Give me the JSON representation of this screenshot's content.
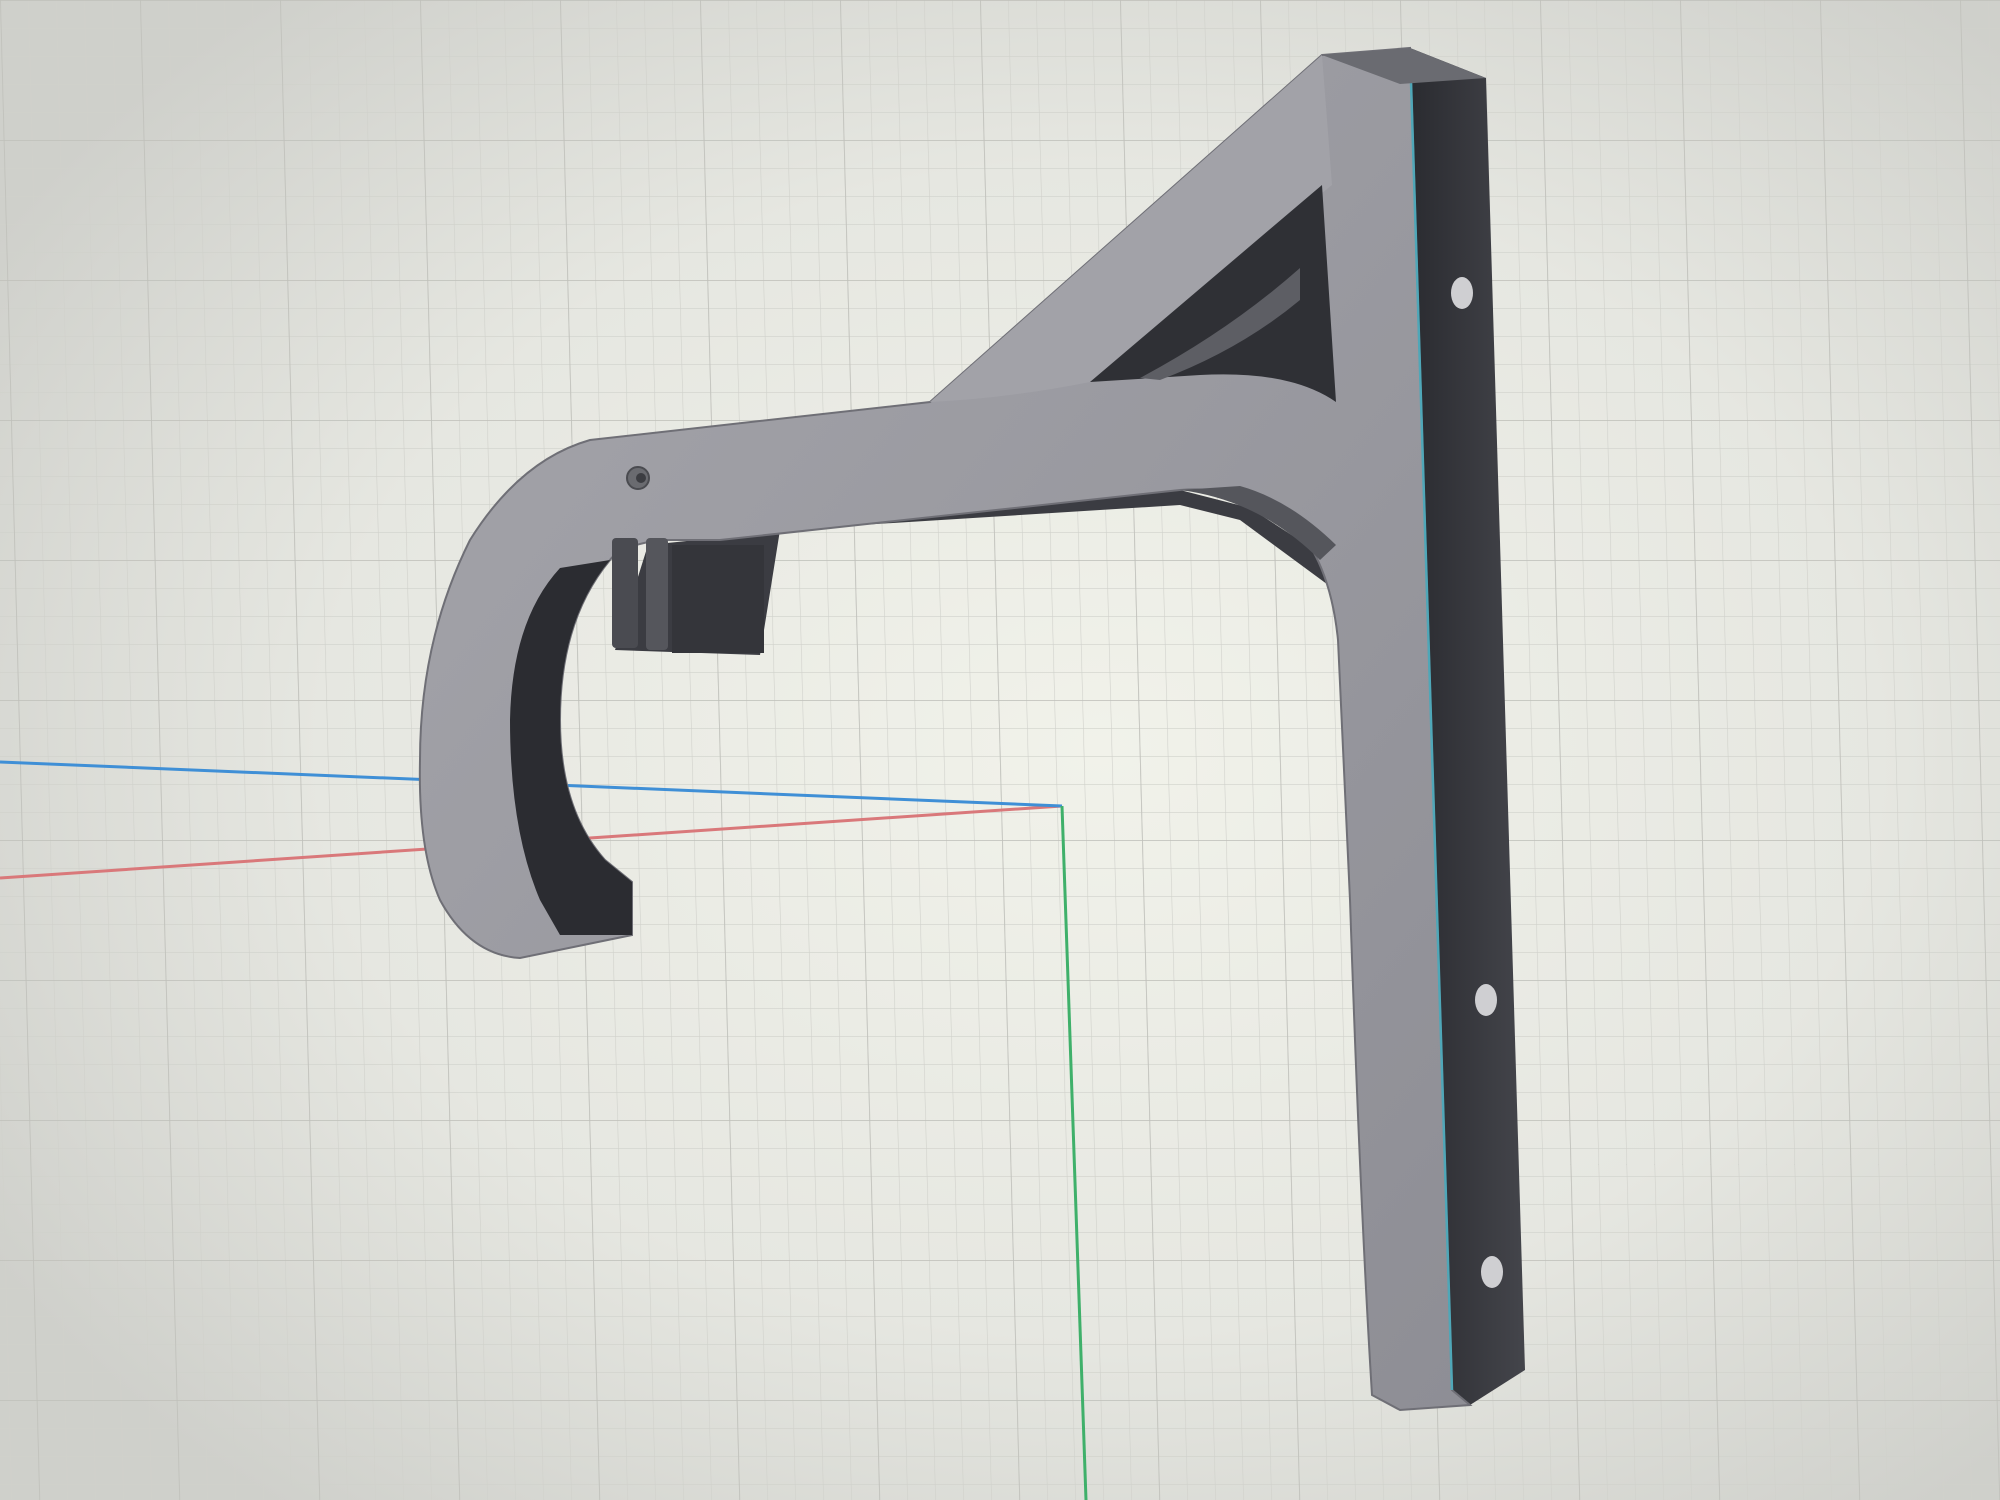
{
  "viewport": {
    "background_color": "#e4e5e0",
    "grid_minor_color": "#d2d3cd",
    "grid_major_color": "#c3c4bd",
    "axis_colors": {
      "x_axis": "#d9787a",
      "y_axis": "#3f8fd6",
      "z_axis": "#3fb06a"
    }
  },
  "model": {
    "name_icon": "bracket-hook-model",
    "face_color": "#9c9ca2",
    "face_light_color": "#a8a8ad",
    "edge_dark_color": "#2c2d31",
    "side_color": "#3a3b40",
    "highlight_edge_color": "#4fa7b8",
    "mounting_holes": 3,
    "pin_holes": 1
  }
}
